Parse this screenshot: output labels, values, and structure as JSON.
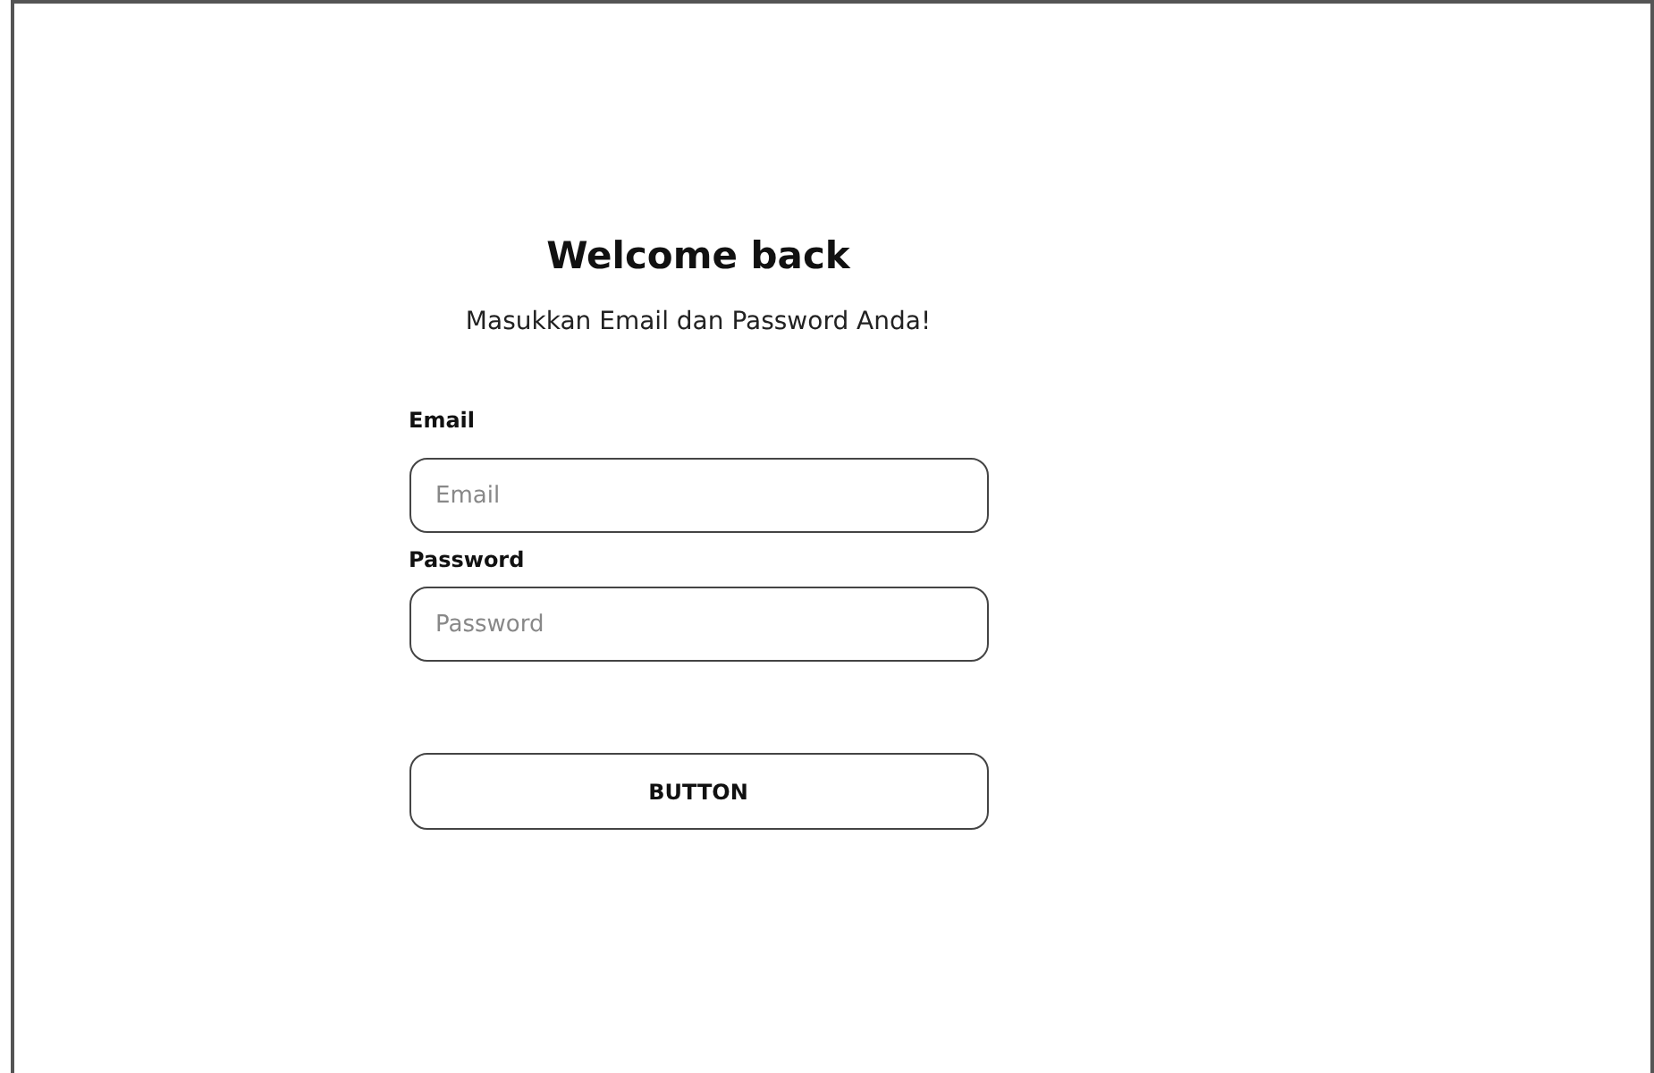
{
  "title": "Welcome back",
  "subtitle": "Masukkan Email dan Password Anda!",
  "fields": [
    {
      "label": "Email",
      "placeholder": "Email"
    },
    {
      "label": "Password",
      "placeholder": "Password"
    }
  ],
  "button": "BUTTON"
}
